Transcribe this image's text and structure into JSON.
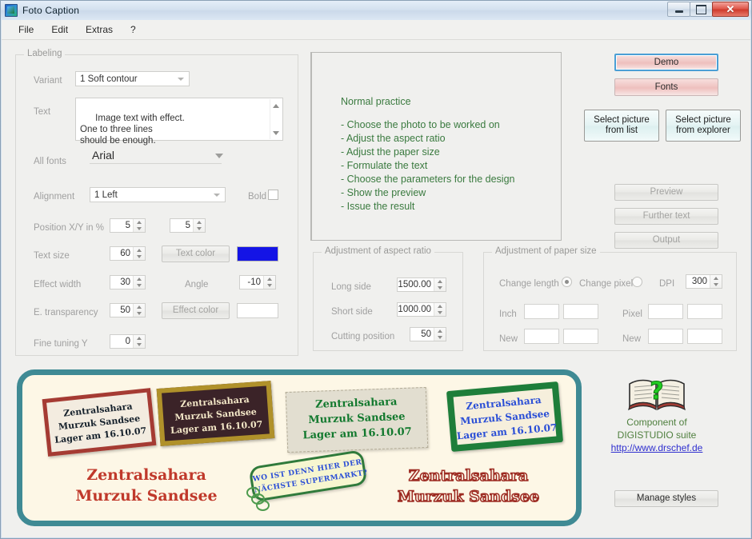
{
  "window": {
    "title": "Foto Caption",
    "app_icon": "app-icon",
    "controls": {
      "minimize": "minimize",
      "maximize": "maximize",
      "close": "✕"
    }
  },
  "menu": {
    "items": [
      "File",
      "Edit",
      "Extras",
      "?"
    ]
  },
  "labeling": {
    "legend": "Labeling",
    "variant_label": "Variant",
    "variant_value": "1 Soft contour",
    "text_label": "Text",
    "text_value": "Image text with effect.\nOne to three lines\nshould be enough.",
    "fonts_label": "All fonts",
    "fonts_value": "Arial",
    "alignment_label": "Alignment",
    "alignment_value": "1 Left",
    "bold_label": "Bold",
    "position_label": "Position X/Y in %",
    "position_x": "5",
    "position_y": "5",
    "text_size_label": "Text size",
    "text_size_value": "60",
    "text_color_button": "Text color",
    "text_color_swatch": "#1414e6",
    "effect_width_label": "Effect width",
    "effect_width_value": "30",
    "angle_label": "Angle",
    "angle_value": "-10",
    "transparency_label": "E. transparency",
    "transparency_value": "50",
    "effect_color_button": "Effect color",
    "effect_color_swatch": "#ffffff",
    "fine_tuning_label": "Fine tuning Y",
    "fine_tuning_value": "0"
  },
  "info_panel": {
    "heading": "Normal practice",
    "lines": [
      "- Choose the photo to be worked on",
      "- Adjust the aspect ratio",
      "- Adjust the paper size",
      "- Formulate the text",
      "- Choose the parameters for the design",
      "- Show the preview",
      "- Issue the result"
    ]
  },
  "actions": {
    "demo": "Demo",
    "fonts": "Fonts",
    "select_from_list": "Select picture\nfrom list",
    "select_from_explorer": "Select picture\nfrom explorer",
    "preview": "Preview",
    "further_text": "Further text",
    "output": "Output",
    "manage_styles": "Manage styles"
  },
  "aspect_ratio": {
    "legend": "Adjustment of aspect ratio",
    "long_side_label": "Long side",
    "long_side_value": "1500.00",
    "short_side_label": "Short side",
    "short_side_value": "1000.00",
    "cutting_label": "Cutting position",
    "cutting_value": "50"
  },
  "paper_size": {
    "legend": "Adjustment of paper size",
    "change_length_label": "Change length",
    "change_pixel_label": "Change pixel",
    "dpi_label": "DPI",
    "dpi_value": "300",
    "inch_label": "Inch",
    "inch_w": "",
    "inch_h": "",
    "new_label_left": "New",
    "new_left_w": "",
    "new_left_h": "",
    "pixel_label": "Pixel",
    "pixel_w": "",
    "pixel_h": "",
    "new_label_right": "New",
    "new_right_w": "",
    "new_right_h": ""
  },
  "preview_banner": {
    "stamp_a": {
      "l1": "Zentralsahara",
      "l2": "Murzuk Sandsee",
      "l3": "Lager am 16.10.07"
    },
    "stamp_b": {
      "l1": "Zentralsahara",
      "l2": "Murzuk Sandsee",
      "l3": "Lager am 16.10.07"
    },
    "stamp_c": {
      "l1": "Zentralsahara",
      "l2": "Murzuk Sandsee",
      "l3": "Lager am 16.10.07"
    },
    "stamp_d": {
      "l1": "Zentralsahara",
      "l2": "Murzuk Sandsee",
      "l3": "Lager am 16.10.07"
    },
    "stamp_e": {
      "l1": "WO IST DENN HIER DER",
      "l2": "NÄCHSTE SUPERMARKT?"
    },
    "big_left": {
      "l1": "Zentralsahara",
      "l2": "Murzuk Sandsee"
    },
    "big_right": {
      "l1": "Zentralsahara",
      "l2": "Murzuk Sandsee"
    },
    "border_color": "#3f8a94",
    "background_color": "#fdf7e6"
  },
  "side_info": {
    "logo": "open-book-question-icon",
    "line1": "Component of",
    "line2": "DIGISTUDIO suite",
    "link": "http://www.drschef.de"
  }
}
